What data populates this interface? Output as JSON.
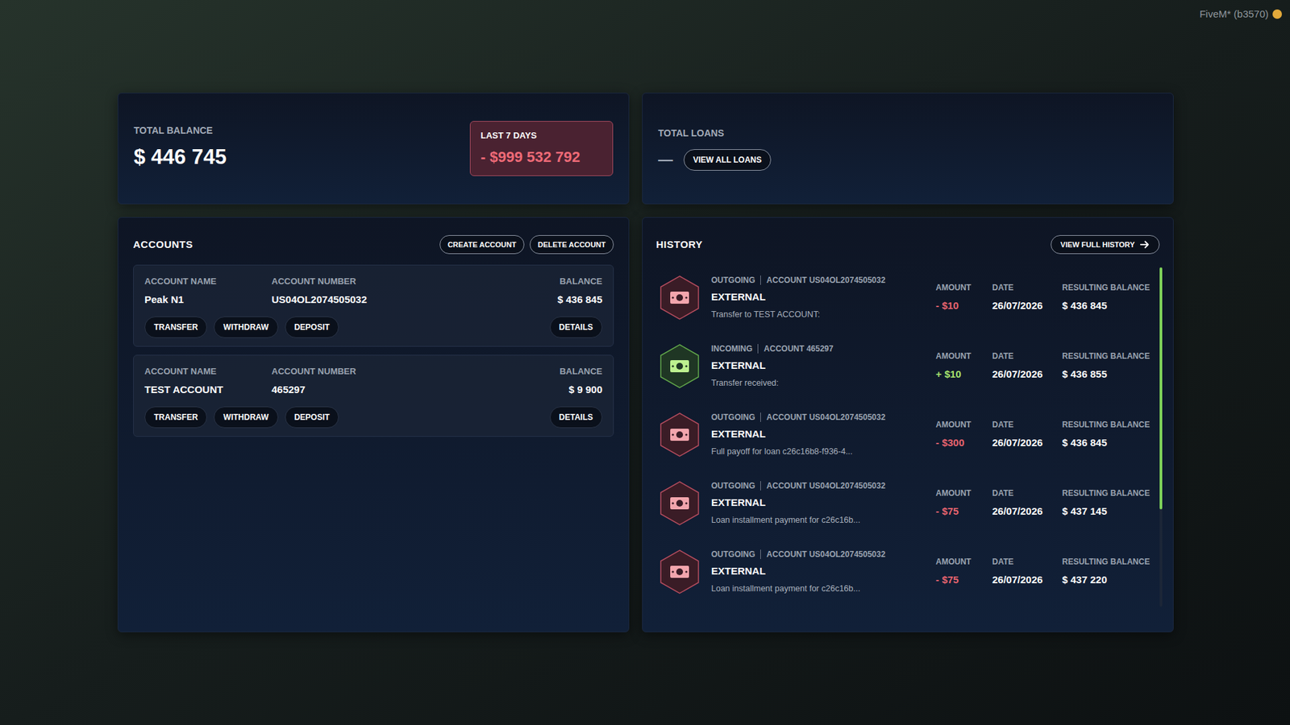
{
  "overlay": {
    "build": "FiveM* (b3570)"
  },
  "balance": {
    "label": "TOTAL BALANCE",
    "value": "$ 446 745",
    "period_label": "LAST 7 DAYS",
    "period_value": "- $999 532 792"
  },
  "loans": {
    "label": "TOTAL LOANS",
    "value": "—",
    "button": "VIEW ALL LOANS"
  },
  "accounts": {
    "title": "ACCOUNTS",
    "buttons": [
      "CREATE ACCOUNT",
      "DELETE ACCOUNT"
    ],
    "items": [
      {
        "name_label": "ACCOUNT NAME",
        "name": "Peak N1",
        "number_label": "ACCOUNT NUMBER",
        "number": "US04OL2074505032",
        "balance_label": "BALANCE",
        "balance": "$ 436 845",
        "actions": [
          "TRANSFER",
          "WITHDRAW",
          "DEPOSIT"
        ],
        "details": "DETAILS"
      },
      {
        "name_label": "ACCOUNT NAME",
        "name": "TEST ACCOUNT",
        "number_label": "ACCOUNT NUMBER",
        "number": "465297",
        "balance_label": "BALANCE",
        "balance": "$ 9 900",
        "actions": [
          "TRANSFER",
          "WITHDRAW",
          "DEPOSIT"
        ],
        "details": "DETAILS"
      }
    ]
  },
  "history": {
    "title": "HISTORY",
    "button": "VIEW FULL HISTORY",
    "items": [
      {
        "kind": "outgoing",
        "direction": "OUTGOING",
        "account": "ACCOUNT US04OL2074505032",
        "type": "EXTERNAL",
        "description": "Transfer to TEST ACCOUNT:",
        "amount_label": "AMOUNT",
        "amount": "- $10",
        "date_label": "DATE",
        "date": "26/07/2026",
        "balance_label": "RESULTING BALANCE",
        "balance": "$ 436 845"
      },
      {
        "kind": "incoming",
        "direction": "INCOMING",
        "account": "ACCOUNT 465297",
        "type": "EXTERNAL",
        "description": "Transfer received:",
        "amount_label": "AMOUNT",
        "amount": "+ $10",
        "date_label": "DATE",
        "date": "26/07/2026",
        "balance_label": "RESULTING BALANCE",
        "balance": "$ 436 855"
      },
      {
        "kind": "outgoing",
        "direction": "OUTGOING",
        "account": "ACCOUNT US04OL2074505032",
        "type": "EXTERNAL",
        "description": "Full payoff for loan c26c16b8-f936-4...",
        "amount_label": "AMOUNT",
        "amount": "- $300",
        "date_label": "DATE",
        "date": "26/07/2026",
        "balance_label": "RESULTING BALANCE",
        "balance": "$ 436 845"
      },
      {
        "kind": "outgoing",
        "direction": "OUTGOING",
        "account": "ACCOUNT US04OL2074505032",
        "type": "EXTERNAL",
        "description": "Loan installment payment for c26c16b...",
        "amount_label": "AMOUNT",
        "amount": "- $75",
        "date_label": "DATE",
        "date": "26/07/2026",
        "balance_label": "RESULTING BALANCE",
        "balance": "$ 437 145"
      },
      {
        "kind": "outgoing",
        "direction": "OUTGOING",
        "account": "ACCOUNT US04OL2074505032",
        "type": "EXTERNAL",
        "description": "Loan installment payment for c26c16b...",
        "amount_label": "AMOUNT",
        "amount": "- $75",
        "date_label": "DATE",
        "date": "26/07/2026",
        "balance_label": "RESULTING BALANCE",
        "balance": "$ 437 220"
      }
    ]
  }
}
